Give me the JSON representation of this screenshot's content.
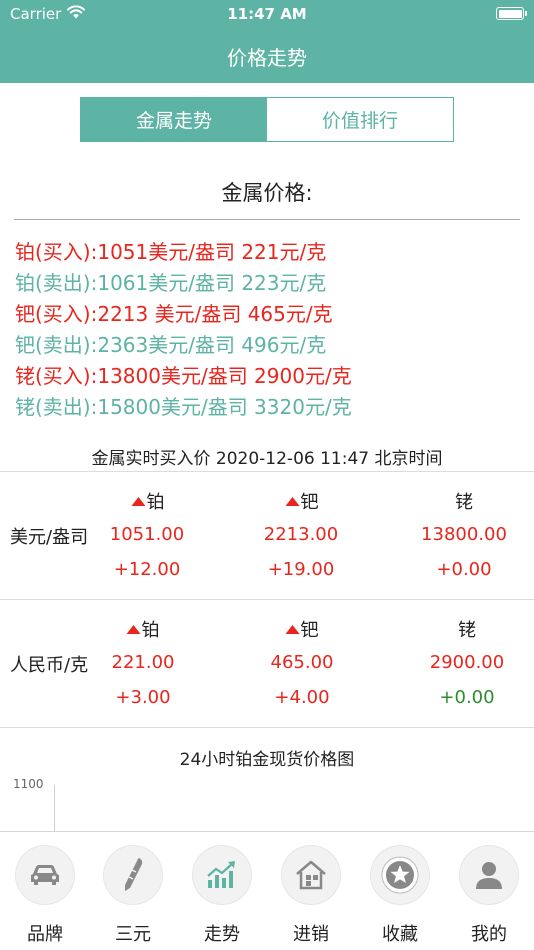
{
  "status_bar": {
    "carrier": "Carrier",
    "time": "11:47 AM"
  },
  "nav": {
    "title": "价格走势"
  },
  "segment": {
    "tabs": [
      {
        "label": "金属走势",
        "active": true
      },
      {
        "label": "价值排行",
        "active": false
      }
    ]
  },
  "metal_prices": {
    "title": "金属价格:",
    "lines": [
      {
        "text": "铂(买入):1051美元/盎司 221元/克",
        "type": "buy"
      },
      {
        "text": "铂(卖出):1061美元/盎司 223元/克",
        "type": "sell"
      },
      {
        "text": "钯(买入):2213 美元/盎司 465元/克",
        "type": "buy"
      },
      {
        "text": "钯(卖出):2363美元/盎司 496元/克",
        "type": "sell"
      },
      {
        "text": "铑(买入):13800美元/盎司 2900元/克",
        "type": "buy"
      },
      {
        "text": "铑(卖出):15800美元/盎司 3320元/克",
        "type": "sell"
      }
    ]
  },
  "realtime": {
    "title": "金属实时买入价 2020-12-06 11:47 北京时间",
    "metals": [
      "铂",
      "钯",
      "铑"
    ],
    "rows": [
      {
        "label": "美元/盎司",
        "up_arrow": [
          true,
          true,
          false
        ],
        "prices": [
          "1051.00",
          "2213.00",
          "13800.00"
        ],
        "changes": [
          "+12.00",
          "+19.00",
          "+0.00"
        ]
      },
      {
        "label": "人民币/克",
        "up_arrow": [
          true,
          true,
          false
        ],
        "prices": [
          "221.00",
          "465.00",
          "2900.00"
        ],
        "changes": [
          "+3.00",
          "+4.00",
          "+0.00"
        ]
      }
    ]
  },
  "chart": {
    "title": "24小时铂金现货价格图",
    "ytick_top": "1100"
  },
  "tabbar": {
    "items": [
      {
        "label": "品牌",
        "icon": "car-icon"
      },
      {
        "label": "三元",
        "icon": "pen-icon"
      },
      {
        "label": "走势",
        "icon": "trend-chart-icon",
        "active": true
      },
      {
        "label": "进销",
        "icon": "house-icon"
      },
      {
        "label": "收藏",
        "icon": "star-icon"
      },
      {
        "label": "我的",
        "icon": "person-icon"
      }
    ]
  },
  "colors": {
    "accent": "#5db3a4",
    "buy": "#e8261e",
    "sell": "#5db3a4",
    "green": "#2e8b2e"
  }
}
